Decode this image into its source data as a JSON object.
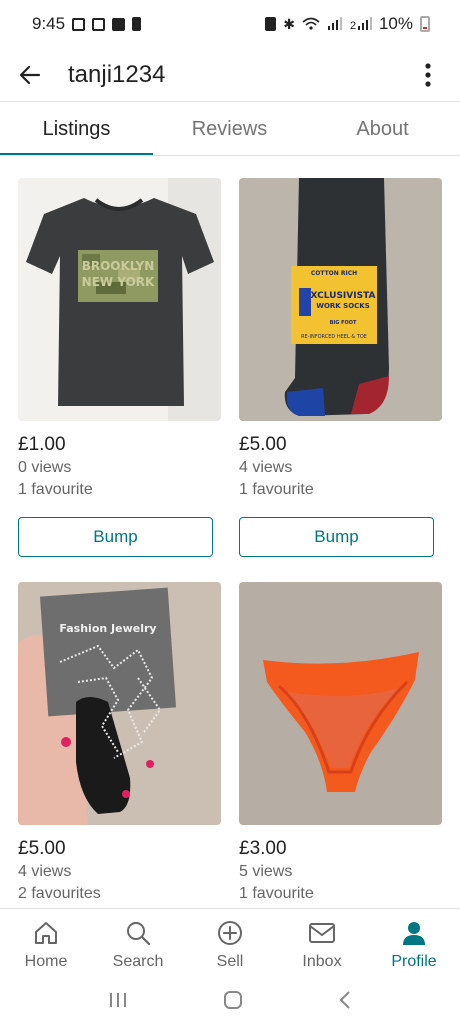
{
  "status_bar": {
    "time": "9:45",
    "battery": "10%"
  },
  "header": {
    "title": "tanji1234"
  },
  "tabs": [
    {
      "label": "Listings"
    },
    {
      "label": "Reviews"
    },
    {
      "label": "About"
    }
  ],
  "listings": [
    {
      "price": "£1.00",
      "views": "0 views",
      "favourites": "1 favourite",
      "bump_label": "Bump",
      "photo": "t-shirt",
      "print_text": [
        "BROOKLYN",
        "NEW YORK"
      ]
    },
    {
      "price": "£5.00",
      "views": "4 views",
      "favourites": "1 favourite",
      "bump_label": "Bump",
      "photo": "socks",
      "tag_text": [
        "COTTON RICH",
        "XCLUSIVISTA",
        "WORK SOCKS",
        "BIG FOOT",
        "RE-INFORCED HEEL & TOE"
      ]
    },
    {
      "price": "£5.00",
      "views": "4 views",
      "favourites": "2 favourites",
      "photo": "jewelry",
      "card_text": "Fashion Jewelry"
    },
    {
      "price": "£3.00",
      "views": "5 views",
      "favourites": "1 favourite",
      "photo": "bikini-bottom"
    }
  ],
  "bottom_nav": [
    {
      "label": "Home",
      "icon": "home-icon"
    },
    {
      "label": "Search",
      "icon": "search-icon"
    },
    {
      "label": "Sell",
      "icon": "plus-circle-icon"
    },
    {
      "label": "Inbox",
      "icon": "mail-icon"
    },
    {
      "label": "Profile",
      "icon": "profile-icon",
      "active": true
    }
  ],
  "colors": {
    "accent": "#007782",
    "text": "#222222",
    "muted": "#666666"
  }
}
